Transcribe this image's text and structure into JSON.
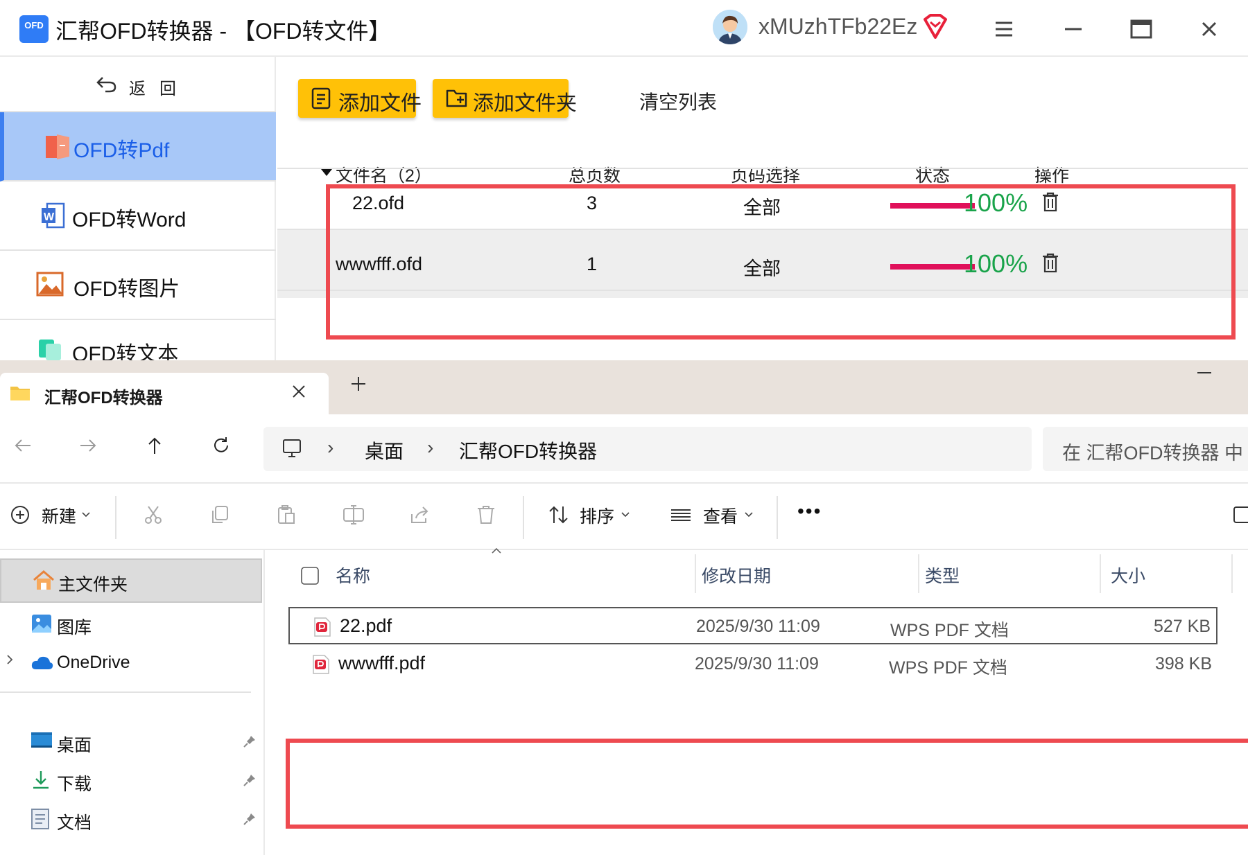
{
  "app": {
    "logo_text": "OFD",
    "title": "汇帮OFD转换器 - 【OFD转文件】",
    "username": "xMUzhTFb22Ez",
    "back_label": "返回",
    "nav": [
      {
        "label": "OFD转Pdf",
        "icon": "pdf-doc-icon",
        "active": true
      },
      {
        "label": "OFD转Word",
        "icon": "word-doc-icon",
        "active": false
      },
      {
        "label": "OFD转图片",
        "icon": "image-icon",
        "active": false
      },
      {
        "label": "OFD转文本",
        "icon": "text-doc-icon",
        "active": false
      }
    ],
    "toolbar": {
      "add_file": "添加文件",
      "add_folder": "添加文件夹",
      "clear_list": "清空列表"
    },
    "table": {
      "col_name": "文件名（2）",
      "col_pages": "总页数",
      "col_page_select": "页码选择",
      "col_status": "状态",
      "col_action": "操作",
      "rows": [
        {
          "name": "22.ofd",
          "pages": "3",
          "page_select": "全部",
          "progress": 1.0,
          "status": "100%"
        },
        {
          "name": "wwwfff.ofd",
          "pages": "1",
          "page_select": "全部",
          "progress": 1.0,
          "status": "100%"
        }
      ]
    },
    "colors": {
      "accent_yellow": "#ffc107",
      "active_nav": "#a8c8f8",
      "progress": "#e0105a",
      "done_green": "#19a34a",
      "highlight": "#ee4a50"
    }
  },
  "explorer": {
    "tab_title": "汇帮OFD转换器",
    "breadcrumb": [
      "桌面",
      "汇帮OFD转换器"
    ],
    "search_placeholder": "在 汇帮OFD转换器 中",
    "commands": {
      "new": "新建",
      "sort": "排序",
      "view": "查看",
      "more": "•••"
    },
    "nav_pane": [
      {
        "label": "主文件夹",
        "icon": "home-icon",
        "selected": true
      },
      {
        "label": "图库",
        "icon": "gallery-icon"
      },
      {
        "label": "OneDrive",
        "icon": "cloud-icon"
      },
      {
        "label": "桌面",
        "icon": "desktop-icon",
        "pinned": true
      },
      {
        "label": "下载",
        "icon": "download-icon",
        "pinned": true
      },
      {
        "label": "文档",
        "icon": "document-icon",
        "pinned": true
      }
    ],
    "columns": {
      "name": "名称",
      "modified": "修改日期",
      "type": "类型",
      "size": "大小"
    },
    "files": [
      {
        "name": "22.pdf",
        "modified": "2025/9/30 11:09",
        "type": "WPS PDF 文档",
        "size": "527 KB"
      },
      {
        "name": "wwwfff.pdf",
        "modified": "2025/9/30 11:09",
        "type": "WPS PDF 文档",
        "size": "398 KB"
      }
    ]
  }
}
